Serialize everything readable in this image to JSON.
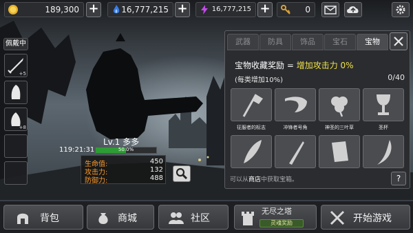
{
  "resources": {
    "gold": "189,300",
    "gems": "16,777,215",
    "energy": "16,777,215",
    "keys": "0"
  },
  "equipment": {
    "wearing_label": "佩戴中",
    "slot_counts": [
      "+5",
      "",
      "+8",
      "",
      ""
    ]
  },
  "player": {
    "level_name": "Lv.1 多多",
    "timer": "119:21:31",
    "exp_percent": 50.0,
    "exp_text": "50.0%",
    "stats": [
      {
        "label": "生命值:",
        "value": "450"
      },
      {
        "label": "攻击力:",
        "value": "132"
      },
      {
        "label": "防御力:",
        "value": "488"
      }
    ]
  },
  "panel": {
    "tabs": [
      "武器",
      "防具",
      "饰品",
      "宝石",
      "宝物"
    ],
    "active_tab": 4,
    "title_prefix": "宝物收藏奖励 =",
    "title_bonus": "增加攻击力 0%",
    "subtitle": "(每类增加10%)",
    "count": "0/40",
    "treasures": [
      {
        "name": "征服者的标志",
        "icon": "banner-staff-icon"
      },
      {
        "name": "冲锋者号角",
        "icon": "horn-icon"
      },
      {
        "name": "神圣的三叶草",
        "icon": "clover-icon"
      },
      {
        "name": "圣杯",
        "icon": "chalice-icon"
      },
      {
        "name": "",
        "icon": "feather-icon"
      },
      {
        "name": "",
        "icon": "dagger-icon"
      },
      {
        "name": "",
        "icon": "scroll-icon"
      },
      {
        "name": "",
        "icon": "fang-icon"
      }
    ],
    "hint_prefix": "可以从",
    "hint_link": "商店",
    "hint_suffix": "中获取宝箱。",
    "help_label": "?"
  },
  "bottom": {
    "bag": "背包",
    "shop": "商城",
    "community": "社区",
    "tower": "无尽之塔",
    "tower_sub": "灵魂奖励",
    "start": "开始游戏"
  },
  "colors": {
    "accent_yellow": "#f2e24a",
    "stat_orange": "#ff9a2a",
    "exp_green": "#2e9c34"
  }
}
